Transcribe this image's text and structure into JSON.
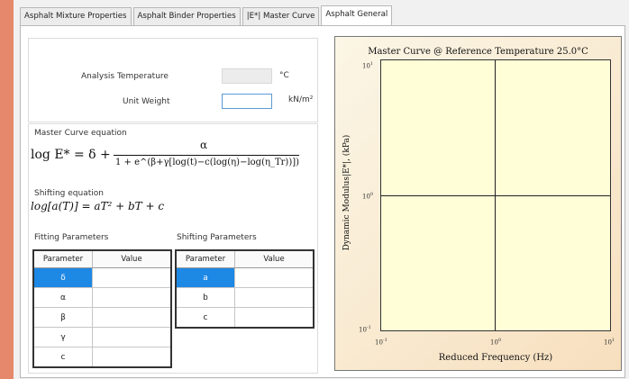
{
  "tabs": [
    {
      "label": "Asphalt Mixture Properties",
      "active": false
    },
    {
      "label": "Asphalt Binder Properties",
      "active": false
    },
    {
      "label": "|E*| Master Curve",
      "active": false
    },
    {
      "label": "Asphalt General",
      "active": true
    }
  ],
  "properties": {
    "analysis_temperature": {
      "label": "Analysis Temperature",
      "value": "",
      "unit": "°C"
    },
    "unit_weight": {
      "label": "Unit Weight",
      "value": "",
      "unit": "kN/m²"
    }
  },
  "master_curve": {
    "title": "Master Curve equation",
    "equation_lhs": "log E* = δ +",
    "numerator": "α",
    "denominator": "1 + e^(β+γ[log(t)−c(log(η)−log(η_Tr))])"
  },
  "shifting": {
    "title": "Shifting equation",
    "equation": "log[a(T)] = aT² + bT + c"
  },
  "fitting_parameters": {
    "title": "Fitting Parameters",
    "columns": [
      "Parameter",
      "Value"
    ],
    "rows": [
      {
        "param": "δ",
        "value": "",
        "selected": true
      },
      {
        "param": "α",
        "value": "",
        "selected": false
      },
      {
        "param": "β",
        "value": "",
        "selected": false
      },
      {
        "param": "γ",
        "value": "",
        "selected": false
      },
      {
        "param": "c",
        "value": "",
        "selected": false
      }
    ]
  },
  "shifting_parameters": {
    "title": "Shifting Parameters",
    "columns": [
      "Parameter",
      "Value"
    ],
    "rows": [
      {
        "param": "a",
        "value": "",
        "selected": true
      },
      {
        "param": "b",
        "value": "",
        "selected": false
      },
      {
        "param": "c",
        "value": "",
        "selected": false
      }
    ]
  },
  "chart_data": {
    "type": "line",
    "title": "Master Curve @ Reference Temperature 25.0°C",
    "xlabel": "Reduced Frequency (Hz)",
    "ylabel": "Dynamic Modulus|E*|, (kPa)",
    "x_scale": "log",
    "y_scale": "log",
    "xlim": [
      0.1,
      10
    ],
    "ylim": [
      0.1,
      10
    ],
    "x_ticks": [
      {
        "base": "10",
        "exp": "-1"
      },
      {
        "base": "10",
        "exp": "0"
      },
      {
        "base": "10",
        "exp": "1"
      }
    ],
    "y_ticks": [
      {
        "base": "10",
        "exp": "1"
      },
      {
        "base": "10",
        "exp": "0"
      },
      {
        "base": "10",
        "exp": "-1"
      }
    ],
    "series": [],
    "grid": true
  },
  "colors": {
    "accent": "#1e88e5",
    "plot_bg": "#fffed6",
    "side_stripe": "#e6886c"
  }
}
